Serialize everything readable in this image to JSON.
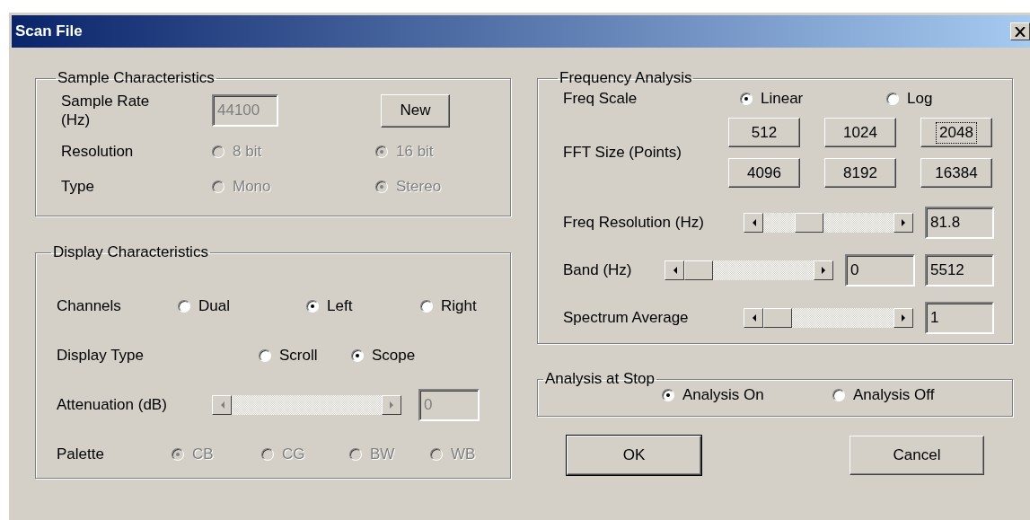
{
  "window": {
    "title": "Scan File"
  },
  "sample": {
    "title": "Sample Characteristics",
    "disabled": true,
    "rate": {
      "label": "Sample Rate (Hz)",
      "value": "44100"
    },
    "new_button": "New",
    "resolution": {
      "label": "Resolution",
      "options": [
        {
          "label": "8 bit",
          "selected": false
        },
        {
          "label": "16 bit",
          "selected": true
        }
      ]
    },
    "type": {
      "label": "Type",
      "options": [
        {
          "label": "Mono",
          "selected": false
        },
        {
          "label": "Stereo",
          "selected": true
        }
      ]
    }
  },
  "display": {
    "title": "Display Characteristics",
    "channels": {
      "label": "Channels",
      "options": [
        {
          "label": "Dual",
          "selected": false
        },
        {
          "label": "Left",
          "selected": true
        },
        {
          "label": "Right",
          "selected": false
        }
      ]
    },
    "display_type": {
      "label": "Display Type",
      "options": [
        {
          "label": "Scroll",
          "selected": false
        },
        {
          "label": "Scope",
          "selected": true
        }
      ]
    },
    "attenuation": {
      "label": "Attenuation (dB)",
      "value": "0",
      "disabled": true
    },
    "palette": {
      "label": "Palette",
      "disabled": true,
      "options": [
        {
          "label": "CB",
          "selected": true
        },
        {
          "label": "CG",
          "selected": false
        },
        {
          "label": "BW",
          "selected": false
        },
        {
          "label": "WB",
          "selected": false
        }
      ]
    }
  },
  "frequency": {
    "title": "Frequency Analysis",
    "freq_scale": {
      "label": "Freq Scale",
      "options": [
        {
          "label": "Linear",
          "selected": true
        },
        {
          "label": "Log",
          "selected": false
        }
      ]
    },
    "fft_size": {
      "label": "FFT Size (Points)",
      "buttons": [
        {
          "label": "512",
          "focused": false
        },
        {
          "label": "1024",
          "focused": false
        },
        {
          "label": "2048",
          "focused": true
        },
        {
          "label": "4096",
          "focused": false
        },
        {
          "label": "8192",
          "focused": false
        },
        {
          "label": "16384",
          "focused": false
        }
      ]
    },
    "freq_resolution": {
      "label": "Freq Resolution (Hz)",
      "level": 0.31,
      "value": "81.8"
    },
    "band": {
      "label": "Band (Hz)",
      "level": 0,
      "low": "0",
      "high": "5512"
    },
    "spectrum_average": {
      "label": "Spectrum Average",
      "level": 0,
      "value": "1"
    }
  },
  "analysis_at_stop": {
    "title": "Analysis at Stop",
    "options": [
      {
        "label": "Analysis On",
        "selected": true
      },
      {
        "label": "Analysis Off",
        "selected": false
      }
    ]
  },
  "buttons": [
    {
      "label": "OK",
      "default": true
    },
    {
      "label": "Cancel",
      "default": false
    }
  ]
}
